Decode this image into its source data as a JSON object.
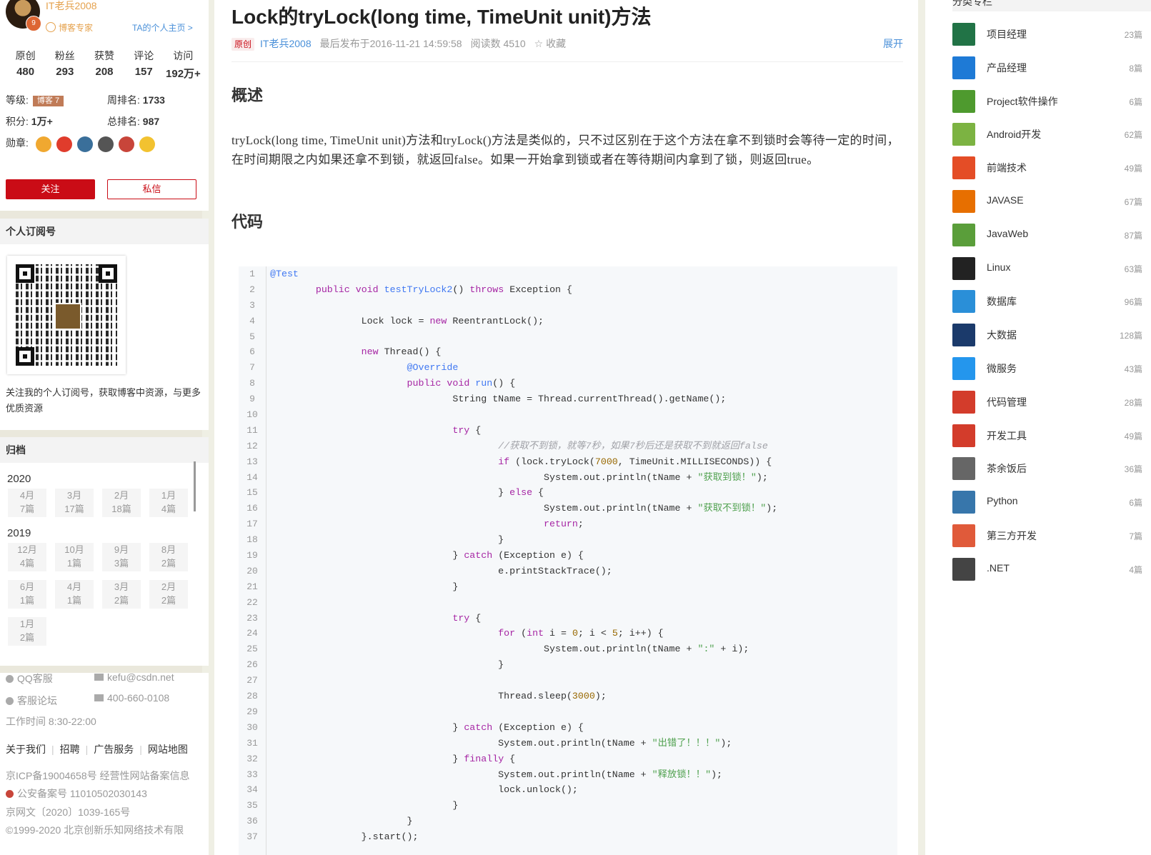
{
  "profile": {
    "username": "IT老兵2008",
    "avatar_badge": "9",
    "title": "博客专家",
    "homepage_link": "TA的个人主页 >",
    "stats": [
      {
        "label": "原创",
        "value": "480"
      },
      {
        "label": "粉丝",
        "value": "293"
      },
      {
        "label": "获赞",
        "value": "208"
      },
      {
        "label": "评论",
        "value": "157"
      },
      {
        "label": "访问",
        "value": "192万+"
      }
    ],
    "grade_label": "等级:",
    "grade_badge": "博客 7",
    "week_rank_label": "周排名:",
    "week_rank": "1733",
    "points_label": "积分:",
    "points": "1万+",
    "total_rank_label": "总排名:",
    "total_rank": "987",
    "medals_label": "勋章:",
    "follow": "关注",
    "message": "私信"
  },
  "subscription": {
    "title": "个人订阅号",
    "text": "关注我的个人订阅号，获取博客中资源，与更多优质资源"
  },
  "archive": {
    "title": "归档",
    "years": [
      {
        "year": "2020",
        "months": [
          {
            "m": "4月",
            "n": "7篇"
          },
          {
            "m": "3月",
            "n": "17篇"
          },
          {
            "m": "2月",
            "n": "18篇"
          },
          {
            "m": "1月",
            "n": "4篇"
          }
        ]
      },
      {
        "year": "2019",
        "months": [
          {
            "m": "12月",
            "n": "4篇"
          },
          {
            "m": "10月",
            "n": "1篇"
          },
          {
            "m": "9月",
            "n": "3篇"
          },
          {
            "m": "8月",
            "n": "2篇"
          },
          {
            "m": "6月",
            "n": "1篇"
          },
          {
            "m": "4月",
            "n": "1篇"
          },
          {
            "m": "3月",
            "n": "2篇"
          },
          {
            "m": "2月",
            "n": "2篇"
          },
          {
            "m": "1月",
            "n": "2篇"
          }
        ]
      }
    ]
  },
  "footer": {
    "qq": "QQ客服",
    "email": "kefu@csdn.net",
    "forum": "客服论坛",
    "phone": "400-660-0108",
    "hours": "工作时间 8:30-22:00",
    "links": [
      "关于我们",
      "招聘",
      "广告服务",
      "网站地图"
    ],
    "icp": "京ICP备19004658号  经营性网站备案信息",
    "police": "公安备案号 11010502030143",
    "wenwang": "京网文〔2020〕1039-165号",
    "copyright": "©1999-2020 北京创新乐知网络技术有限"
  },
  "article": {
    "title": "Lock的tryLock(long time, TimeUnit unit)方法",
    "tag": "原创",
    "author": "IT老兵2008",
    "published": "最后发布于2016-11-21 14:59:58",
    "reads": "阅读数 4510",
    "favorite": "收藏",
    "expand": "展开",
    "h_overview": "概述",
    "overview": "tryLock(long time, TimeUnit unit)方法和tryLock()方法是类似的，只不过区别在于这个方法在拿不到锁时会等待一定的时间，在时间期限之内如果还拿不到锁，就返回false。如果一开始拿到锁或者在等待期间内拿到了锁，则返回true。",
    "h_code": "代码"
  },
  "code_lines": [
    [
      [
        "an",
        "@Test"
      ]
    ],
    [
      [
        "",
        "        "
      ],
      [
        "kw",
        "public"
      ],
      [
        "",
        " "
      ],
      [
        "kw",
        "void"
      ],
      [
        "",
        " "
      ],
      [
        "fn",
        "testTryLock2"
      ],
      [
        "",
        "() "
      ],
      [
        "kw",
        "throws"
      ],
      [
        "",
        " Exception {"
      ]
    ],
    [],
    [
      [
        "",
        "                Lock lock = "
      ],
      [
        "kw",
        "new"
      ],
      [
        "",
        " ReentrantLock();"
      ]
    ],
    [],
    [
      [
        "",
        "                "
      ],
      [
        "kw",
        "new"
      ],
      [
        "",
        " Thread() {"
      ]
    ],
    [
      [
        "",
        "                        "
      ],
      [
        "an",
        "@Override"
      ]
    ],
    [
      [
        "",
        "                        "
      ],
      [
        "kw",
        "public"
      ],
      [
        "",
        " "
      ],
      [
        "kw",
        "void"
      ],
      [
        "",
        " "
      ],
      [
        "fn",
        "run"
      ],
      [
        "",
        "() {"
      ]
    ],
    [
      [
        "",
        "                                String tName = Thread.currentThread().getName();"
      ]
    ],
    [],
    [
      [
        "",
        "                                "
      ],
      [
        "kw",
        "try"
      ],
      [
        "",
        " {"
      ]
    ],
    [
      [
        "",
        "                                        "
      ],
      [
        "cm",
        "//获取不到锁，就等7秒，如果7秒后还是获取不到就返回false"
      ]
    ],
    [
      [
        "",
        "                                        "
      ],
      [
        "kw",
        "if"
      ],
      [
        "",
        " (lock.tryLock("
      ],
      [
        "nm",
        "7000"
      ],
      [
        "",
        ", TimeUnit.MILLISECONDS)) {"
      ]
    ],
    [
      [
        "",
        "                                                System.out.println(tName + "
      ],
      [
        "st",
        "\"获取到锁！\""
      ],
      [
        "",
        ");"
      ]
    ],
    [
      [
        "",
        "                                        } "
      ],
      [
        "kw",
        "else"
      ],
      [
        "",
        " {"
      ]
    ],
    [
      [
        "",
        "                                                System.out.println(tName + "
      ],
      [
        "st",
        "\"获取不到锁！\""
      ],
      [
        "",
        ");"
      ]
    ],
    [
      [
        "",
        "                                                "
      ],
      [
        "kw",
        "return"
      ],
      [
        "",
        ";"
      ]
    ],
    [
      [
        "",
        "                                        }"
      ]
    ],
    [
      [
        "",
        "                                } "
      ],
      [
        "kw",
        "catch"
      ],
      [
        "",
        " (Exception e) {"
      ]
    ],
    [
      [
        "",
        "                                        e.printStackTrace();"
      ]
    ],
    [
      [
        "",
        "                                }"
      ]
    ],
    [],
    [
      [
        "",
        "                                "
      ],
      [
        "kw",
        "try"
      ],
      [
        "",
        " {"
      ]
    ],
    [
      [
        "",
        "                                        "
      ],
      [
        "kw",
        "for"
      ],
      [
        "",
        " ("
      ],
      [
        "kw",
        "int"
      ],
      [
        "",
        " i = "
      ],
      [
        "nm",
        "0"
      ],
      [
        "",
        "; i < "
      ],
      [
        "nm",
        "5"
      ],
      [
        "",
        "; i++) {"
      ]
    ],
    [
      [
        "",
        "                                                System.out.println(tName + "
      ],
      [
        "st",
        "\":\""
      ],
      [
        "",
        " + i);"
      ]
    ],
    [
      [
        "",
        "                                        }"
      ]
    ],
    [],
    [
      [
        "",
        "                                        Thread.sleep("
      ],
      [
        "nm",
        "3000"
      ],
      [
        "",
        ");"
      ]
    ],
    [],
    [
      [
        "",
        "                                } "
      ],
      [
        "kw",
        "catch"
      ],
      [
        "",
        " (Exception e) {"
      ]
    ],
    [
      [
        "",
        "                                        System.out.println(tName + "
      ],
      [
        "st",
        "\"出错了！！！\""
      ],
      [
        "",
        ");"
      ]
    ],
    [
      [
        "",
        "                                } "
      ],
      [
        "kw",
        "finally"
      ],
      [
        "",
        " {"
      ]
    ],
    [
      [
        "",
        "                                        System.out.println(tName + "
      ],
      [
        "st",
        "\"释放锁！！\""
      ],
      [
        "",
        ");"
      ]
    ],
    [
      [
        "",
        "                                        lock.unlock();"
      ]
    ],
    [
      [
        "",
        "                                }"
      ]
    ],
    [
      [
        "",
        "                        }"
      ]
    ],
    [
      [
        "",
        "                }.start();"
      ]
    ]
  ],
  "categories_title": "分类专栏",
  "categories": [
    {
      "name": "项目经理",
      "count": "23篇",
      "icon": "project-icon",
      "color": "#217346"
    },
    {
      "name": "产品经理",
      "count": "8篇",
      "icon": "axure-icon",
      "color": "#1e7ad6"
    },
    {
      "name": "Project软件操作",
      "count": "6篇",
      "icon": "ms-project-icon",
      "color": "#4e9a2e"
    },
    {
      "name": "Android开发",
      "count": "62篇",
      "icon": "android-icon",
      "color": "#7cb342"
    },
    {
      "name": "前端技术",
      "count": "49篇",
      "icon": "html5-css3-js-icon",
      "color": "#e44d26"
    },
    {
      "name": "JAVASE",
      "count": "67篇",
      "icon": "java-icon",
      "color": "#e76f00"
    },
    {
      "name": "JavaWeb",
      "count": "87篇",
      "icon": "javaweb-icon",
      "color": "#5a9e3a"
    },
    {
      "name": "Linux",
      "count": "63篇",
      "icon": "linux-tux-icon",
      "color": "#222222"
    },
    {
      "name": "数据库",
      "count": "96篇",
      "icon": "sql-database-icon",
      "color": "#2a8fd8"
    },
    {
      "name": "大数据",
      "count": "128篇",
      "icon": "big-data-icon",
      "color": "#1b3a6b"
    },
    {
      "name": "微服务",
      "count": "43篇",
      "icon": "docker-icon",
      "color": "#2496ed"
    },
    {
      "name": "代码管理",
      "count": "28篇",
      "icon": "git-icon",
      "color": "#d33c2b"
    },
    {
      "name": "开发工具",
      "count": "49篇",
      "icon": "tools-icon",
      "color": "#d33c2b"
    },
    {
      "name": "茶余饭后",
      "count": "36篇",
      "icon": "tea-icon",
      "color": "#666666"
    },
    {
      "name": "Python",
      "count": "6篇",
      "icon": "python-icon",
      "color": "#3776ab"
    },
    {
      "name": "第三方开发",
      "count": "7篇",
      "icon": "third-party-icon",
      "color": "#e05a3a"
    },
    {
      "name": ".NET",
      "count": "4篇",
      "icon": "aspnet-icon",
      "color": "#444444"
    }
  ]
}
